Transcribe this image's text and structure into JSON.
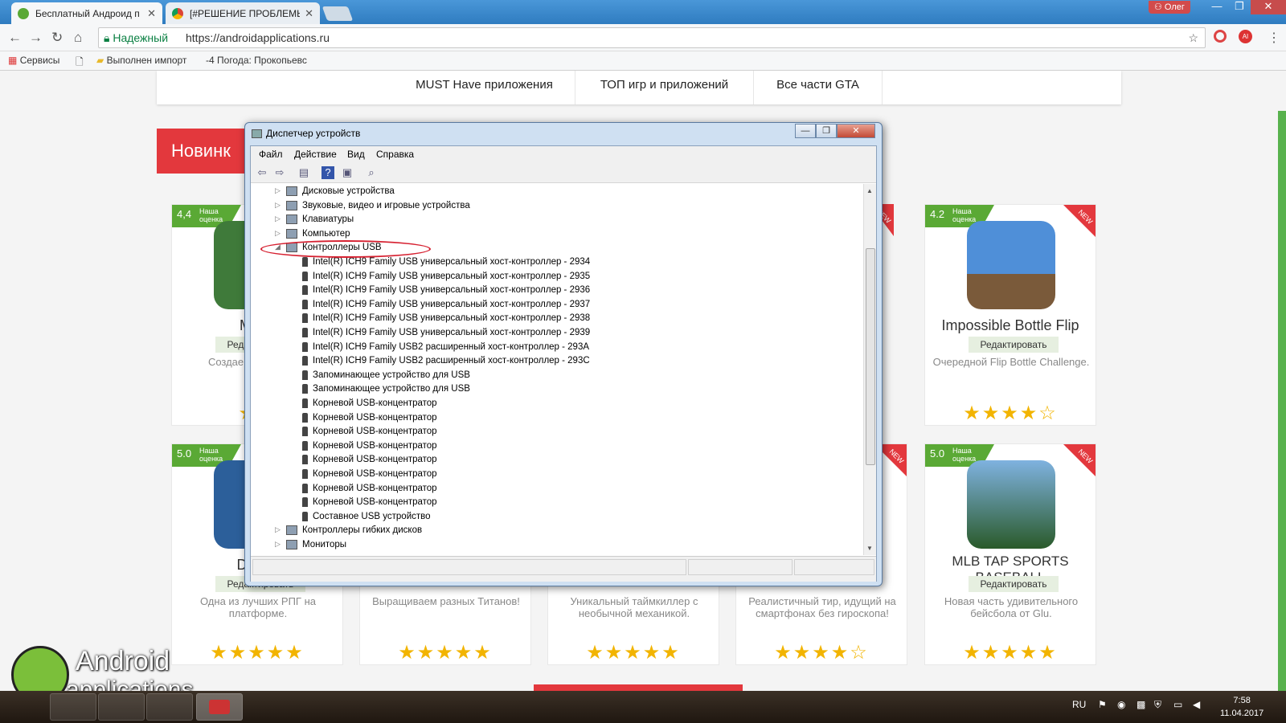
{
  "browser": {
    "tabs": [
      {
        "title": "Бесплатный Андроид п",
        "active": true
      },
      {
        "title": "[#РЕШЕНИЕ ПРОБЛЕМЫ",
        "active": false
      }
    ],
    "user_chip": "Олег",
    "secure_label": "Надежный",
    "url": "https://androidapplications.ru",
    "ext_badge": "AI",
    "bookmarks": [
      "Сервисы",
      "Выполнен импорт",
      "-4",
      "Погода: Прокопьевс"
    ]
  },
  "site": {
    "menu": [
      "MUST Have приложения",
      "ТОП игр и приложений",
      "Все части GTA"
    ],
    "section_title": "Новинк",
    "logo_line1": "Android",
    "logo_line2": "applications",
    "rating_label": "Наша оценка",
    "new_label": "NEW",
    "edit_label": "Редактировать",
    "cards": [
      {
        "rating": "4,4",
        "title": "Mons",
        "desc": "Создае монстр сраж",
        "stars": "★★"
      },
      {
        "rating": "4.2",
        "title": "Impossible Bottle Flip",
        "desc": "Очередной Flip Bottle Challenge.",
        "stars": "★★★★☆"
      },
      {
        "rating": "5.0",
        "title": "Dynas",
        "desc": "Одна из лучших РПГ на платформе.",
        "stars": "★★★★★"
      },
      {
        "rating": "",
        "title": "",
        "desc": "Выращиваем разных Титанов!",
        "stars": "★★★★★"
      },
      {
        "rating": "",
        "title": "",
        "desc": "Уникальный таймкиллер с необычной механикой.",
        "stars": "★★★★★"
      },
      {
        "rating": "",
        "title": "",
        "desc": "Реалистичный тир, идущий на смартфонах без гироскопа!",
        "stars": "★★★★☆"
      },
      {
        "rating": "5.0",
        "title": "MLB TAP SPORTS BASEBALL",
        "desc": "Новая часть удивительного бейсбола от Glu.",
        "stars": "★★★★★"
      }
    ]
  },
  "device_manager": {
    "title": "Диспетчер устройств",
    "menu": [
      "Файл",
      "Действие",
      "Вид",
      "Справка"
    ],
    "tree": [
      {
        "label": "Дисковые устройства",
        "level": 0,
        "expander": "▷"
      },
      {
        "label": "Звуковые, видео и игровые устройства",
        "level": 0,
        "expander": "▷"
      },
      {
        "label": "Клавиатуры",
        "level": 0,
        "expander": "▷"
      },
      {
        "label": "Компьютер",
        "level": 0,
        "expander": "▷"
      },
      {
        "label": "Контроллеры USB",
        "level": 0,
        "expander": "◢"
      },
      {
        "label": "Intel(R) ICH9 Family USB универсальный хост-контроллер  - 2934",
        "level": 1
      },
      {
        "label": "Intel(R) ICH9 Family USB универсальный хост-контроллер  - 2935",
        "level": 1
      },
      {
        "label": "Intel(R) ICH9 Family USB универсальный хост-контроллер  - 2936",
        "level": 1
      },
      {
        "label": "Intel(R) ICH9 Family USB универсальный хост-контроллер  - 2937",
        "level": 1
      },
      {
        "label": "Intel(R) ICH9 Family USB универсальный хост-контроллер  - 2938",
        "level": 1
      },
      {
        "label": "Intel(R) ICH9 Family USB универсальный хост-контроллер  - 2939",
        "level": 1
      },
      {
        "label": "Intel(R) ICH9 Family USB2 расширенный хост-контроллер  - 293A",
        "level": 1
      },
      {
        "label": "Intel(R) ICH9 Family USB2 расширенный хост-контроллер  - 293C",
        "level": 1
      },
      {
        "label": "Запоминающее устройство для USB",
        "level": 1
      },
      {
        "label": "Запоминающее устройство для USB",
        "level": 1
      },
      {
        "label": "Корневой USB-концентратор",
        "level": 1
      },
      {
        "label": "Корневой USB-концентратор",
        "level": 1
      },
      {
        "label": "Корневой USB-концентратор",
        "level": 1
      },
      {
        "label": "Корневой USB-концентратор",
        "level": 1
      },
      {
        "label": "Корневой USB-концентратор",
        "level": 1
      },
      {
        "label": "Корневой USB-концентратор",
        "level": 1
      },
      {
        "label": "Корневой USB-концентратор",
        "level": 1
      },
      {
        "label": "Корневой USB-концентратор",
        "level": 1
      },
      {
        "label": "Составное USB устройство",
        "level": 1
      },
      {
        "label": "Контроллеры гибких дисков",
        "level": 0,
        "expander": "▷"
      },
      {
        "label": "Мониторы",
        "level": 0,
        "expander": "▷"
      }
    ]
  },
  "taskbar": {
    "lang": "RU",
    "time": "7:58",
    "date": "11.04.2017"
  }
}
